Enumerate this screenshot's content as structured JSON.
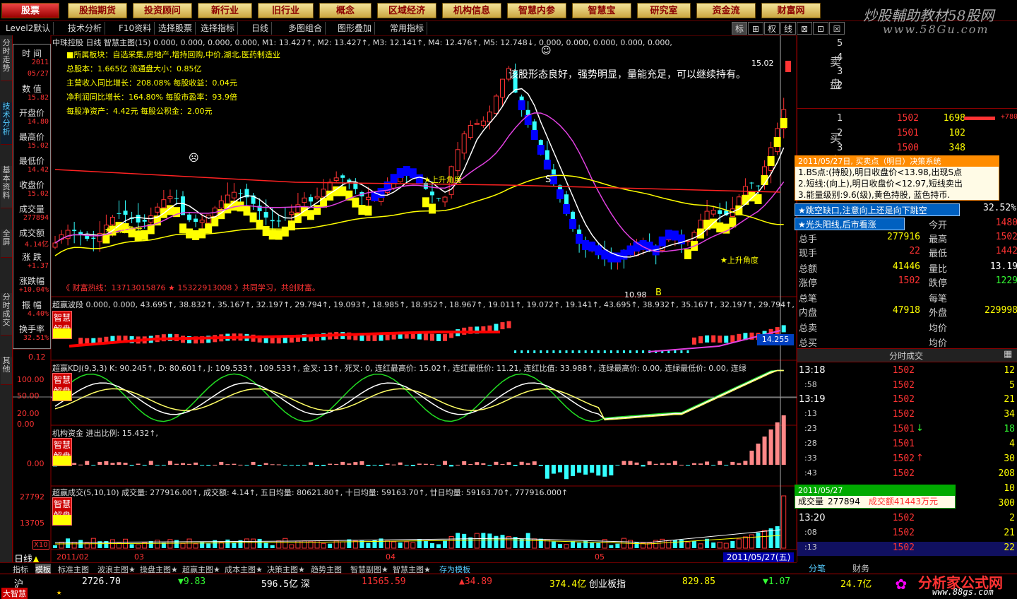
{
  "menu": {
    "active": "股票",
    "items": [
      "股票",
      "股指期货",
      "投资顾问",
      "新行业",
      "旧行业",
      "概念",
      "区域经济",
      "机构信息",
      "智慧内参",
      "智慧宝",
      "研究室",
      "资金流",
      "财富网"
    ]
  },
  "watermark": {
    "line1": "炒股輔助教材58股网",
    "line2": "www.58Gu.com"
  },
  "toolbar": {
    "items": [
      "Level2默认",
      "技术分析",
      "F10资料",
      "选择股票",
      "选择指标",
      "日线",
      "多图组合",
      "图形叠加",
      "常用指标"
    ],
    "right_buttons": [
      "标",
      "⊞",
      "权",
      "线",
      "⊠",
      "⊡",
      "☒"
    ]
  },
  "left_nav": [
    {
      "label": "分时走势",
      "active": false
    },
    {
      "label": "技术分析",
      "active": true
    },
    {
      "label": "基本资料",
      "active": false
    },
    {
      "label": "全屏",
      "active": false
    },
    {
      "label": "分时成交",
      "active": false
    },
    {
      "label": "其他",
      "active": false
    }
  ],
  "info_panel": [
    {
      "label": "时  间",
      "value": "2011"
    },
    {
      "label": "",
      "value": "05/27"
    },
    {
      "label": "数  值",
      "value": "15.82"
    },
    {
      "label": "开盘价",
      "value": "14.80"
    },
    {
      "label": "最高价",
      "value": "15.02"
    },
    {
      "label": "最低价",
      "value": "14.42"
    },
    {
      "label": "收盘价",
      "value": "15.02"
    },
    {
      "label": "成交量",
      "value": "277894"
    },
    {
      "label": "成交额",
      "value": "4.14亿"
    },
    {
      "label": "涨  跌",
      "value": "+1.37"
    },
    {
      "label": "涨跌幅",
      "value": "+10.04%"
    },
    {
      "label": "振  幅",
      "value": "4.40%"
    },
    {
      "label": "换手率",
      "value": "32.51%"
    }
  ],
  "main_chart": {
    "header": "中珠控股 日线  智慧主图(15) 0.000, 0.000, 0.000, 0.000, M1: 13.427↑, M2: 13.427↑, M3: 12.141↑, M4: 12.476↑,  M5: 12.748↓, 0.000, 0.000, 0.000, 0.000, 0.000,",
    "info_lines": [
      "■所属板块：自选采集,房地产,增持回购,中价,湖北,医药制造业",
      "总股本：1.665亿          流通盘大小：0.85亿",
      "主营收入同比增长：208.08%  每股收益：0.04元",
      "净利润同比增长：164.80%   每股市盈率：93.9倍",
      "每股净资产：4.42元        每股公积金：2.00元"
    ],
    "comment": "该股形态良好，强势明显，量能充足，可以继续持有。",
    "contact": "《 财富热线：13713015876 ★ 15322913008 》共同学习，共创财富。",
    "labels": [
      "★上升角度",
      "★上升角度",
      "★上升角度"
    ],
    "s_label": "S",
    "b_label": "B",
    "high_price": "15.02",
    "low_price": "10.98",
    "y_axis": [
      "15.82",
      "14.80",
      "15.02",
      "14.42",
      "15.02"
    ]
  },
  "wave_panel": {
    "header": "超赢波段 0.000, 0.000, 43.695↑, 38.832↑, 35.167↑, 32.197↑, 29.794↑, 19.093↑, 18.985↑, 18.952↑, 18.967↑, 19.011↑, 19.072↑, 19.141↑, 43.695↑, 38.932↑, 35.167↑, 32.197↑, 29.794↑, 19",
    "tag_top": "智慧",
    "tag_bot": "解盘",
    "axis_value": "0.12",
    "price_tag": "14.255"
  },
  "kdj_panel": {
    "header": "超赢KDJ(9,3,3)  K: 90.245↑, D: 80.601↑, J: 109.533↑, 109.533↑, 金叉: 13↑, 死叉: 0, 连红最高价: 15.02↑, 连红最低价: 11.21, 连红比值: 33.988↑, 连绿最高价: 0.00, 连绿最低价: 0.00, 连绿",
    "axis": [
      "100.00",
      "50.00",
      "20.00",
      "0.00"
    ],
    "tag_top": "智慧",
    "tag_bot": "解盘"
  },
  "fund_panel": {
    "header": "机构资金 进出比例: 15.432↑,",
    "axis": "0.00",
    "tag_top": "智慧",
    "tag_bot": "解盘"
  },
  "vol_panel": {
    "header": "超赢成交(5,10,10) 成交量: 277916.00↑, 成交额: 4.14↑, 五日均量: 80621.80↑, 十日均量: 59163.70↑, 廿日均量: 59163.70↑, 777916.000↑",
    "axis": [
      "27792",
      "13705",
      "X10"
    ],
    "tag_top": "智慧",
    "tag_bot": "解盘"
  },
  "date_axis": {
    "label": "日线",
    "dates": [
      "2011/02",
      "03",
      "04",
      "05"
    ],
    "current": "2011/05/27(五)"
  },
  "bottom_tabs": [
    "指标",
    "模板",
    "标准主图",
    "波浪主图★",
    "操盘主图★",
    "超赢主图★",
    "成本主图★",
    "决策主图★",
    "趋势主图",
    "智慧副图★",
    "智慧主图★",
    "存为模板"
  ],
  "order_book": {
    "sell_label": "卖盘",
    "buy_label": "买盘",
    "sell_levels": [
      "5",
      "4",
      "3",
      "2"
    ],
    "buy_levels": [
      {
        "level": "1",
        "price": "1502",
        "vol": "1698",
        "extra": "+780"
      },
      {
        "level": "2",
        "price": "1501",
        "vol": "102",
        "extra": ""
      },
      {
        "level": "3",
        "price": "1500",
        "vol": "348",
        "extra": ""
      }
    ]
  },
  "decision_popup": {
    "title": "2011/05/27日, 买卖点（明日）决策系统",
    "lines": [
      "1.BS点:(持股),明日收盘价<13.98,出现S点",
      "2.短线:(向上),明日收盘价<12.97,短线卖出",
      "3.能量级别:9.6(级),黄色持股, 蓝色持币."
    ]
  },
  "signal_1": "★跳空缺口,注意向上还是向下跳空",
  "signal_2": "★光头阳线,后市看涨",
  "turnover_pct": "32.52%",
  "quote": {
    "left": [
      {
        "label": "总手",
        "value": "277916"
      },
      {
        "label": "现手",
        "value": "22"
      },
      {
        "label": "总额",
        "value": "41446"
      },
      {
        "label": "涨停",
        "value": "1502"
      },
      {
        "label": "总笔",
        "value": ""
      },
      {
        "label": "内盘",
        "value": "47918"
      },
      {
        "label": "总卖",
        "value": ""
      },
      {
        "label": "总买",
        "value": ""
      }
    ],
    "right": [
      {
        "label": "今开",
        "value": "1480"
      },
      {
        "label": "最高",
        "value": "1502"
      },
      {
        "label": "最低",
        "value": "1442"
      },
      {
        "label": "量比",
        "value": "13.19"
      },
      {
        "label": "跌停",
        "value": "1229"
      },
      {
        "label": "每笔",
        "value": ""
      },
      {
        "label": "外盘",
        "value": "229998"
      },
      {
        "label": "均价",
        "value": ""
      },
      {
        "label": "均价",
        "value": ""
      }
    ]
  },
  "ticks": {
    "title": "分时成交",
    "rows": [
      {
        "time": "13:18",
        "price": "1502",
        "arrow": "",
        "vol": "12"
      },
      {
        "time": ":58",
        "price": "1502",
        "arrow": "",
        "vol": "5"
      },
      {
        "time": "13:19",
        "price": "1502",
        "arrow": "",
        "vol": "21"
      },
      {
        "time": ":13",
        "price": "1502",
        "arrow": "",
        "vol": "34"
      },
      {
        "time": ":23",
        "price": "1501",
        "arrow": "↓",
        "vol": "18"
      },
      {
        "time": ":28",
        "price": "1501",
        "arrow": "",
        "vol": "4"
      },
      {
        "time": ":33",
        "price": "1502",
        "arrow": "↑",
        "vol": "30"
      },
      {
        "time": ":43",
        "price": "1502",
        "arrow": "",
        "vol": "208"
      },
      {
        "time": "",
        "price": "",
        "arrow": "",
        "vol": "10"
      },
      {
        "time": "",
        "price": "",
        "arrow": "",
        "vol": "300"
      },
      {
        "time": "13:20",
        "price": "1502",
        "arrow": "",
        "vol": "2"
      },
      {
        "time": ":08",
        "price": "1502",
        "arrow": "",
        "vol": "21"
      },
      {
        "time": ":13",
        "price": "1502",
        "arrow": "",
        "vol": "22"
      }
    ]
  },
  "vol_popup": {
    "date": "2011/05/27",
    "vol_label": "成交量",
    "vol": "277894",
    "amount": "成交额41443万元"
  },
  "right_tabs": [
    "分笔",
    "财务"
  ],
  "brand": {
    "name": "分析家公式网",
    "url": "www.88gs.com"
  },
  "status": {
    "index_name": "沪",
    "sh_price": "2726.70",
    "sh_change": "▼9.83",
    "sh_amount": "596.5亿",
    "sz_name": "深",
    "sz_price": "11565.59",
    "sz_change": "▲34.89",
    "sz_amount": "374.4亿",
    "cy_name": "创业板指",
    "cy_price": "829.85",
    "cy_change": "▼1.07",
    "total": "24.7亿",
    "app": "大智慧"
  },
  "colors": {
    "up": "#ff3333",
    "down": "#33ffff",
    "accent": "#ffff00",
    "ma_white": "#ffffff",
    "ma_magenta": "#e040e0",
    "ma_yellow": "#ffff00",
    "ma_red": "#ff2222",
    "blue": "#0000ff"
  }
}
